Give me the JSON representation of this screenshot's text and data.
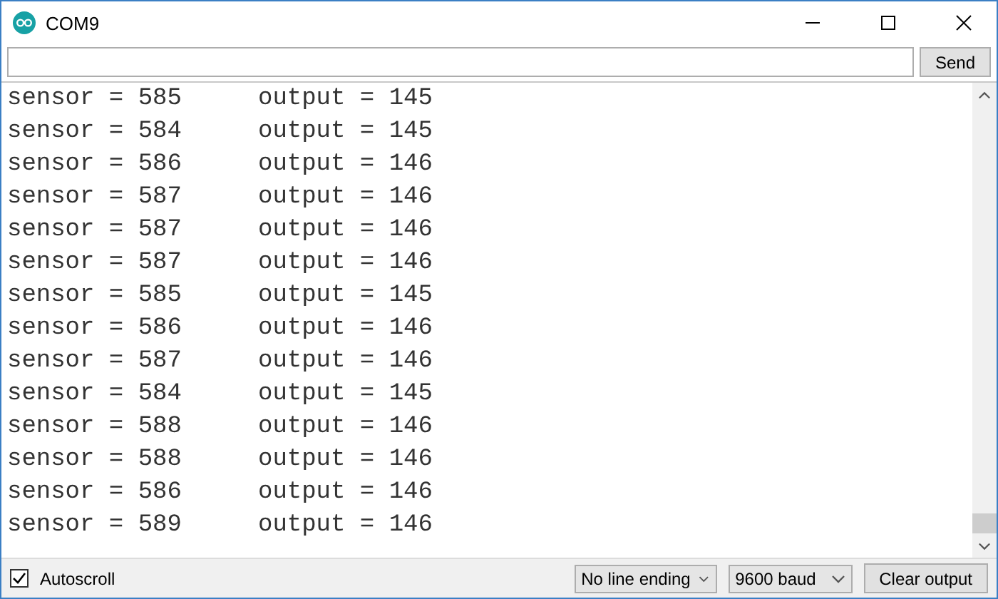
{
  "window": {
    "title": "COM9"
  },
  "send_button": {
    "label": "Send"
  },
  "lines": [
    {
      "sensor": "sensor = 585",
      "output": "output = 145"
    },
    {
      "sensor": "sensor = 584",
      "output": "output = 145"
    },
    {
      "sensor": "sensor = 586",
      "output": "output = 146"
    },
    {
      "sensor": "sensor = 587",
      "output": "output = 146"
    },
    {
      "sensor": "sensor = 587",
      "output": "output = 146"
    },
    {
      "sensor": "sensor = 587",
      "output": "output = 146"
    },
    {
      "sensor": "sensor = 585",
      "output": "output = 145"
    },
    {
      "sensor": "sensor = 586",
      "output": "output = 146"
    },
    {
      "sensor": "sensor = 587",
      "output": "output = 146"
    },
    {
      "sensor": "sensor = 584",
      "output": "output = 145"
    },
    {
      "sensor": "sensor = 588",
      "output": "output = 146"
    },
    {
      "sensor": "sensor = 588",
      "output": "output = 146"
    },
    {
      "sensor": "sensor = 586",
      "output": "output = 146"
    },
    {
      "sensor": "sensor = 589",
      "output": "output = 146"
    }
  ],
  "autoscroll": {
    "label": "Autoscroll",
    "checked": true
  },
  "line_ending": {
    "value": "No line ending"
  },
  "baud": {
    "value": "9600 baud"
  },
  "clear_button": {
    "label": "Clear output"
  }
}
